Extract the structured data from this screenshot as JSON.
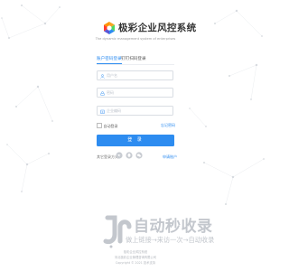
{
  "brand": {
    "name": "极彩企业风控系统",
    "slogan": "The dynamic management system of enterprises"
  },
  "tabs": [
    {
      "label": "账户密码登录",
      "active": true
    },
    {
      "label": "钉钉扫码登录",
      "active": false
    }
  ],
  "form": {
    "username_placeholder": "用户名",
    "password_placeholder": "密码",
    "code_placeholder": "企业编码",
    "remember_label": "自动登录",
    "forgot_label": "忘记密码",
    "submit_label": "登 录"
  },
  "other": {
    "label": "其它登录方式",
    "icons": [
      "dingtalk-icon",
      "qq-icon",
      "wechat-icon"
    ],
    "register_label": "申请账户"
  },
  "watermark": {
    "title": "自动秒收录",
    "subtitle": "做上链接→来访一次→自动收录"
  },
  "footer": {
    "line1": "极彩企业风控系统",
    "line2": "河北极彩企业管理咨询有限公司",
    "line3": "Copyright © 2021 技术支持"
  },
  "colors": {
    "accent": "#2d8cf0",
    "border": "#d9dde3",
    "watermark": "#c3c7cd"
  }
}
